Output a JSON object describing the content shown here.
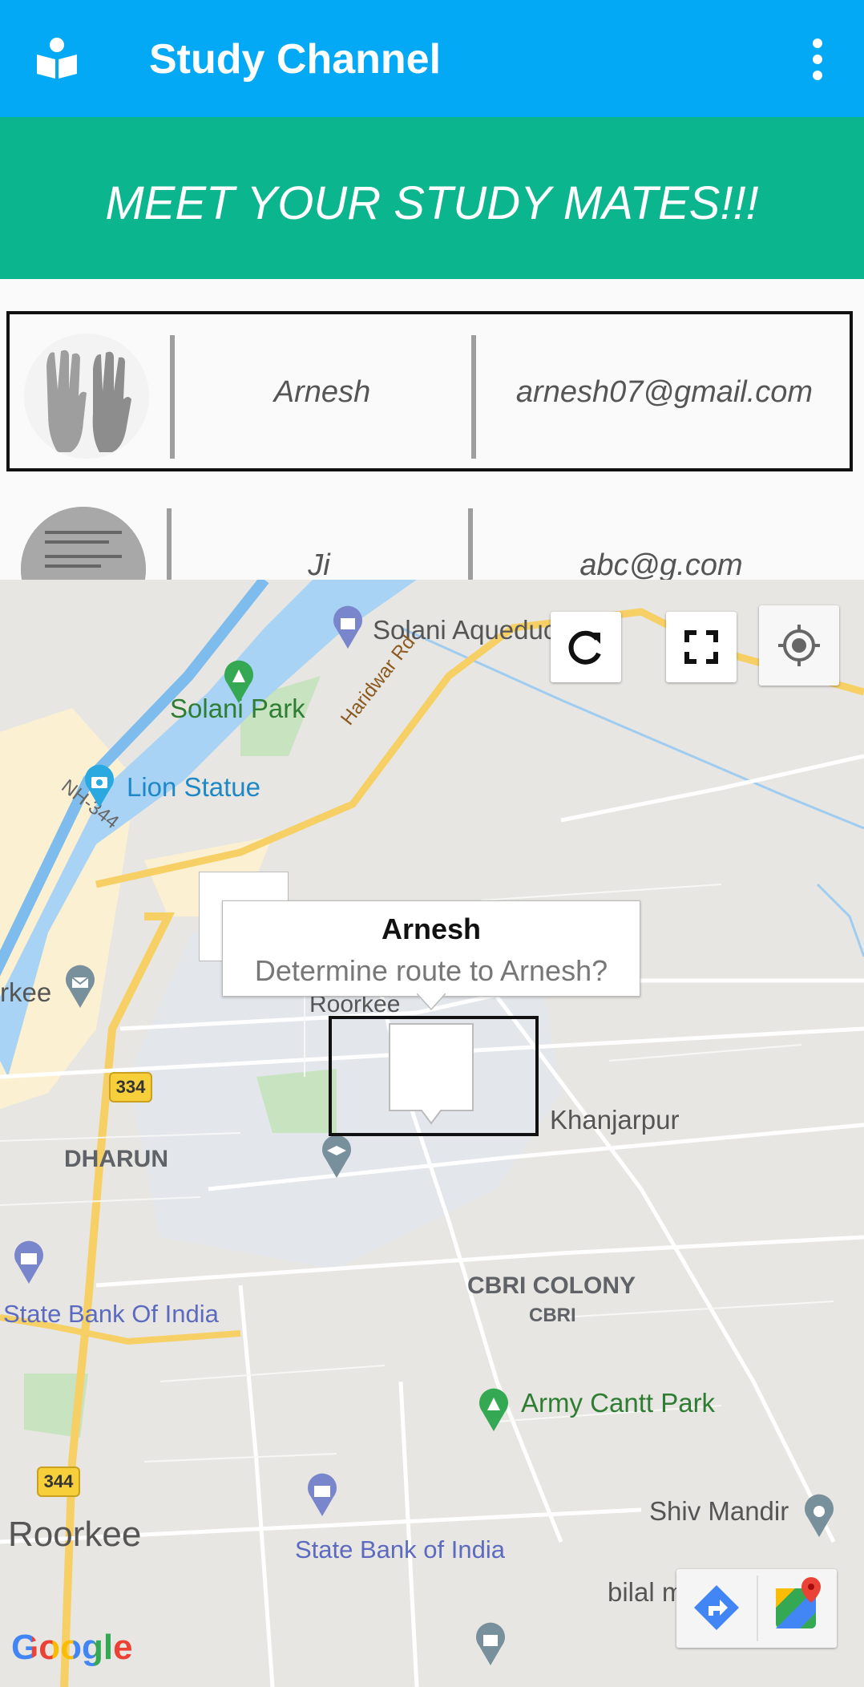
{
  "app": {
    "title": "Study Channel"
  },
  "banner": {
    "text": "MEET YOUR STUDY MATES!!!"
  },
  "mates": [
    {
      "name": "Arnesh",
      "email": "arnesh07@gmail.com"
    },
    {
      "name": "Ji",
      "email": "abc@g.com"
    }
  ],
  "map": {
    "popup": {
      "title": "Arnesh",
      "subtitle": "Determine route to Arnesh?"
    },
    "places": {
      "solani_aqueduct": "Solani Aqueduc",
      "solani_park": "Solani Park",
      "haridwar_rd": "Haridwar Rd",
      "nh344": "NH-344",
      "lion_statue": "Lion Statue",
      "rkee": "rkee",
      "roorkee_small": "Roorkee",
      "khanjarpur": "Khanjarpur",
      "dharun": "DHARUN",
      "state_bank_1": "State Bank Of India",
      "cbri_colony": "CBRI COLONY",
      "cbri": "CBRI",
      "army_cantt_park": "Army Cantt Park",
      "shiv_mandir": "Shiv Mandir",
      "roorkee_big": "Roorkee",
      "state_bank_2": "State Bank of India",
      "bilal_masjid": "bilal masjid"
    },
    "road_shields": {
      "r334": "334",
      "r344": "344"
    },
    "attribution": "Google",
    "colors": {
      "water": "#8ec3f2",
      "park": "#c8e6c9",
      "urban": "#fdf3d2",
      "road": "#ffffff",
      "highway": "#f6cf65"
    }
  },
  "icons": {
    "app": "book-reader-icon",
    "menu": "more-vert-icon",
    "refresh": "refresh-icon",
    "fullscreen": "fullscreen-icon",
    "location": "my-location-icon",
    "directions": "directions-icon",
    "google_maps": "google-maps-icon"
  }
}
